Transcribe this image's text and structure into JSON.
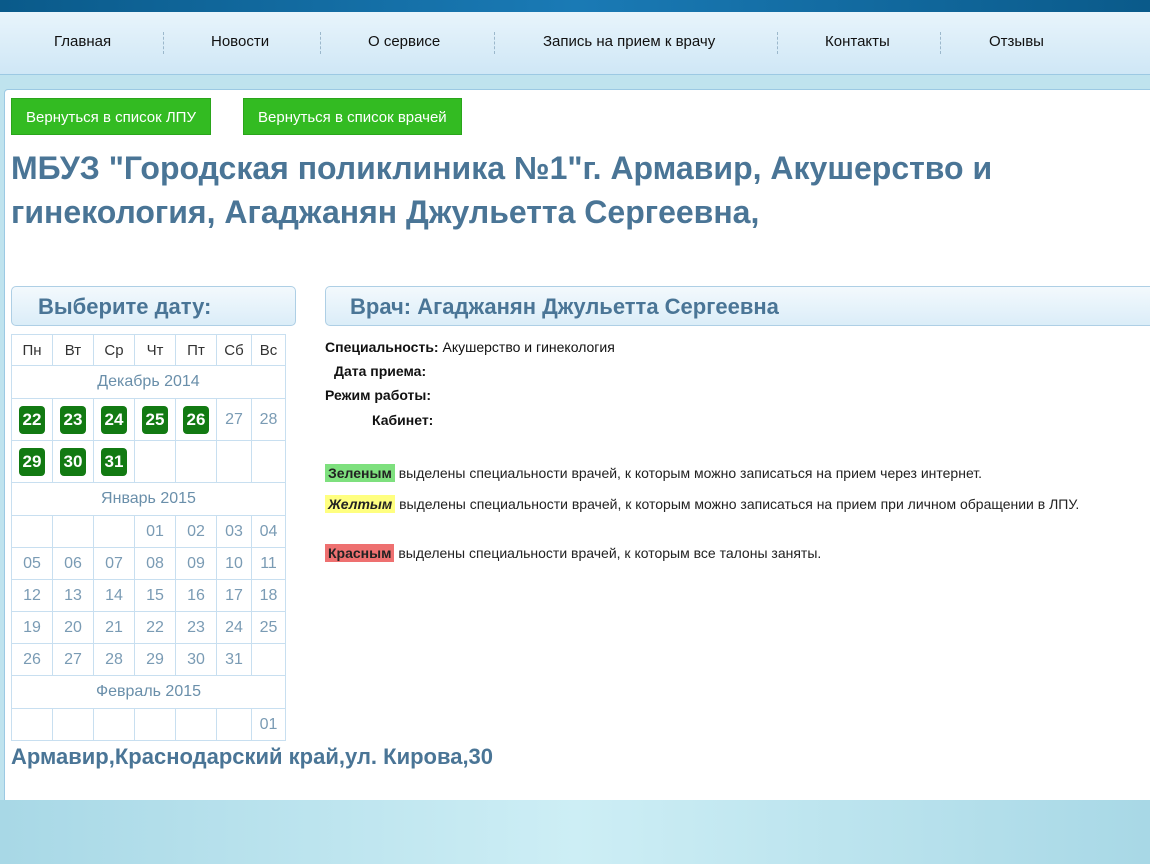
{
  "nav": [
    "Главная",
    "Новости",
    "О сервисе",
    "Запись на прием к врачу",
    "Контакты",
    "Отзывы"
  ],
  "buttons": {
    "back_lpu": "Вернуться в список ЛПУ",
    "back_doctors": "Вернуться в список врачей"
  },
  "title": "МБУЗ \"Городская поликлиника №1\"г. Армавир, Акушерство и гинекология, Агаджанян Джульетта Сергеевна,",
  "calendar": {
    "heading": "Выберите дату:",
    "weekdays": [
      "Пн",
      "Вт",
      "Ср",
      "Чт",
      "Пт",
      "Сб",
      "Вс"
    ],
    "months": {
      "dec": "Декабрь 2014",
      "jan": "Январь 2015",
      "feb": "Февраль 2015"
    },
    "dec_days": [
      "22",
      "23",
      "24",
      "25",
      "26",
      "27",
      "28",
      "29",
      "30",
      "31"
    ],
    "jan_days": [
      "01",
      "02",
      "03",
      "04",
      "05",
      "06",
      "07",
      "08",
      "09",
      "10",
      "11",
      "12",
      "13",
      "14",
      "15",
      "16",
      "17",
      "18",
      "19",
      "20",
      "21",
      "22",
      "23",
      "24",
      "25",
      "26",
      "27",
      "28",
      "29",
      "30",
      "31"
    ],
    "feb_days": [
      "01"
    ]
  },
  "doctor": {
    "heading": "Врач:  Агаджанян Джульетта Сергеевна",
    "specialty_label": "Специальность:",
    "specialty_value": "Акушерство и гинекология",
    "date_label": "Дата приема:",
    "schedule_label": "Режим работы:",
    "cabinet_label": "Кабинет:"
  },
  "legend": {
    "green_tag": "Зеленым",
    "green_text": " выделены специальности врачей, к которым можно записаться на прием через интернет.",
    "yellow_tag": "Желтым",
    "yellow_text": " выделены специальности врачей, к которым можно записаться на прием при личном обращении в ЛПУ.",
    "red_tag": "Красным",
    "red_text": " выделены специальности врачей, к которым все талоны заняты."
  },
  "address": "Армавир,Краснодарский край,ул. Кирова,30",
  "colors": {
    "green": "#7ee07e",
    "yellow": "#ffff80",
    "red": "#ee7070",
    "available_day": "#127a12",
    "heading": "#4a7596"
  }
}
